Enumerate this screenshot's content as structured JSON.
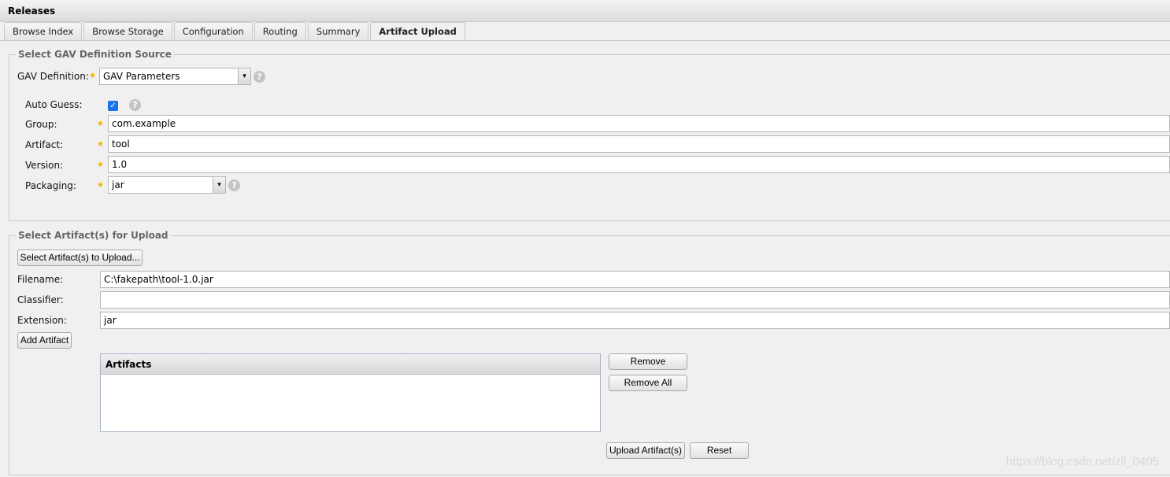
{
  "title": "Releases",
  "tabs": [
    "Browse Index",
    "Browse Storage",
    "Configuration",
    "Routing",
    "Summary",
    "Artifact Upload"
  ],
  "active_tab": "Artifact Upload",
  "gav_section": {
    "legend": "Select GAV Definition Source",
    "definition_label": "GAV Definition:",
    "definition_value": "GAV Parameters",
    "auto_guess_label": "Auto Guess:",
    "auto_guess_checked": true,
    "group_label": "Group:",
    "group_value": "com.example",
    "artifact_label": "Artifact:",
    "artifact_value": "tool",
    "version_label": "Version:",
    "version_value": "1.0",
    "packaging_label": "Packaging:",
    "packaging_value": "jar"
  },
  "upload_section": {
    "legend": "Select Artifact(s) for Upload",
    "select_button": "Select Artifact(s) to Upload...",
    "filename_label": "Filename:",
    "filename_value": "C:\\fakepath\\tool-1.0.jar",
    "classifier_label": "Classifier:",
    "classifier_value": "",
    "extension_label": "Extension:",
    "extension_value": "jar",
    "add_button": "Add Artifact",
    "grid_header": "Artifacts",
    "remove_button": "Remove",
    "remove_all_button": "Remove All",
    "upload_button": "Upload Artifact(s)",
    "reset_button": "Reset"
  },
  "help_glyph": "?",
  "star_glyph": "★",
  "check_glyph": "✓",
  "arrow_glyph": "▾",
  "watermark": "https://blog.csdn.net/zll_0405",
  "colors": {
    "checkbox": "#1a73e8",
    "required_star": "#f0b400"
  }
}
